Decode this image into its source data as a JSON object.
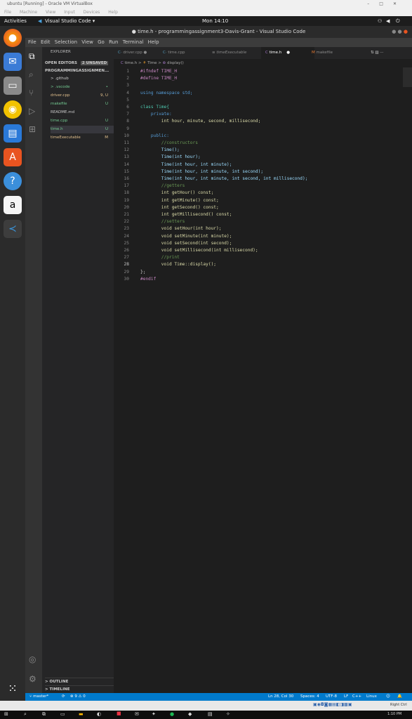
{
  "vbox": {
    "title": "ubuntu [Running] - Oracle VM VirtualBox",
    "controls": [
      "–",
      "□",
      "✕"
    ],
    "menu": [
      "File",
      "Machine",
      "View",
      "Input",
      "Devices",
      "Help"
    ]
  },
  "ubuntu": {
    "activities": "Activities",
    "app_menu": "Visual Studio Code ▾",
    "clock": "Mon 14:10"
  },
  "vscode": {
    "window_title": "● time.h - programmingassignment3-Davis-Grant - Visual Studio Code",
    "menu": [
      "File",
      "Edit",
      "Selection",
      "View",
      "Go",
      "Run",
      "Terminal",
      "Help"
    ],
    "explorer": {
      "header": "EXPLORER",
      "open_editors": "OPEN EDITORS",
      "unsaved_badge": "2 UNSAVED",
      "project": "PROGRAMMINGASSIGNMEN...",
      "items": [
        {
          "name": "> .github",
          "badge": "",
          "color": "#cccccc"
        },
        {
          "name": "> .vscode",
          "badge": "•",
          "color": "#73c991"
        },
        {
          "name": "driver.cpp",
          "badge": "9, U",
          "color": "#e2c08d"
        },
        {
          "name": "makefile",
          "badge": "U",
          "color": "#73c991"
        },
        {
          "name": "README.md",
          "badge": "",
          "color": "#cccccc"
        },
        {
          "name": "time.cpp",
          "badge": "U",
          "color": "#73c991"
        },
        {
          "name": "time.h",
          "badge": "U",
          "color": "#73c991"
        },
        {
          "name": "timeExecutable",
          "badge": "M",
          "color": "#e2c08d"
        }
      ],
      "outline": "OUTLINE",
      "timeline": "TIMELINE"
    },
    "tabs": [
      "driver.cpp",
      "time.cpp",
      "timeExecutable",
      "time.h",
      "makefile"
    ],
    "breadcrumb": [
      "time.h",
      "Time",
      "display()"
    ],
    "code_lines": [
      "#ifndef TIME_H",
      "#define TIME_H",
      "",
      "using namespace std;",
      "",
      "class Time{",
      "    private:",
      "        int hour, minute, second, millisecond;",
      "",
      "    public:",
      "        //constructors",
      "        Time();",
      "        Time(int hour);",
      "        Time(int hour, int minute);",
      "        Time(int hour, int minute, int second);",
      "        Time(int hour, int minute, int second, int millisecond);",
      "        //getters",
      "        int getHour() const;",
      "        int getMinute() const;",
      "        int getSecond() const;",
      "        int getMillisecond() const;",
      "        //setters",
      "        void setHour(int hour);",
      "        void setMinute(int minute);",
      "        void setSecond(int second);",
      "        void setMillisecond(int millisecond);",
      "        //print",
      "        void Time::display();",
      "};",
      "#endif"
    ],
    "status": {
      "branch": "master*",
      "sync": "⟳",
      "problems": "⊗ 9 ⚠ 0",
      "cursor": "Ln 28, Col 30",
      "spaces": "Spaces: 4",
      "encoding": "UTF-8",
      "eol": "LF",
      "language": "C++",
      "os": "Linux"
    }
  },
  "host": {
    "tray_text": "Right Ctrl",
    "clock": "1:10 PM"
  }
}
